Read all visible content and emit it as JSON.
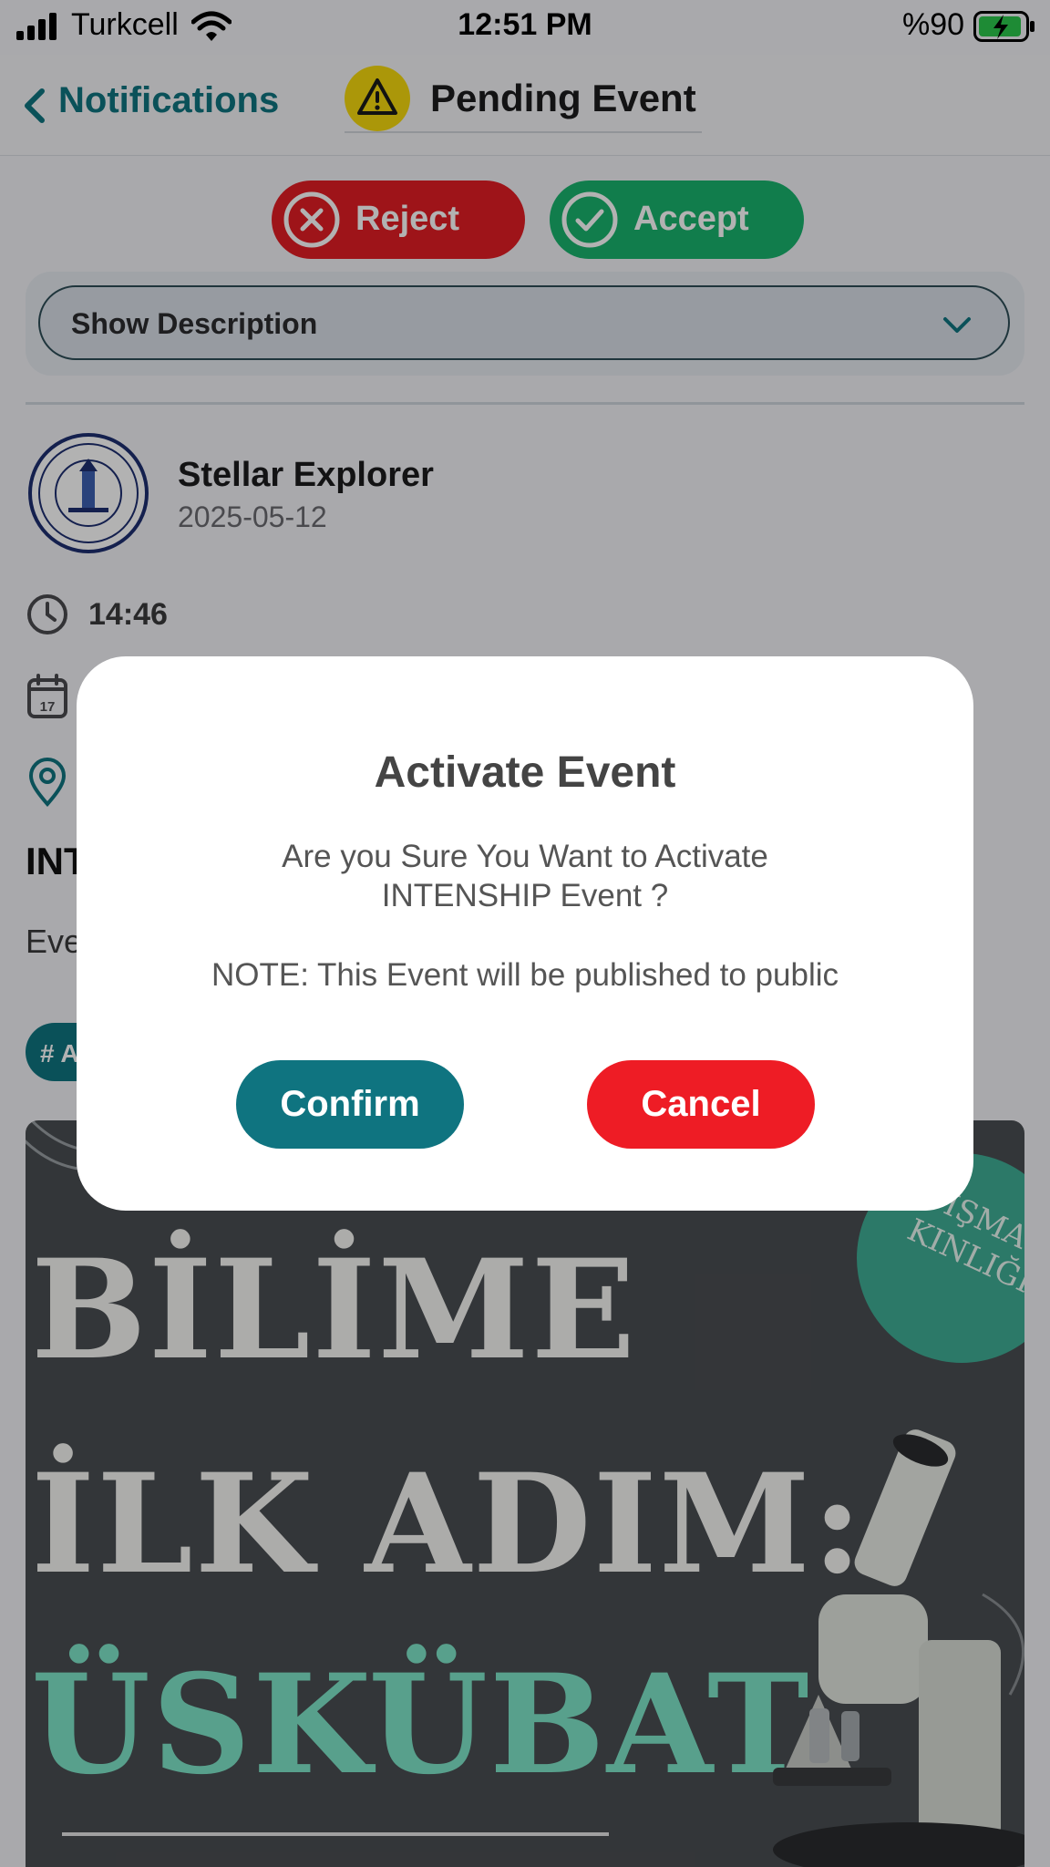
{
  "status_bar": {
    "carrier": "Turkcell",
    "time": "12:51 PM",
    "battery": "%90"
  },
  "nav": {
    "back_label": "Notifications",
    "title": "Pending Event"
  },
  "actions": {
    "reject_label": "Reject",
    "accept_label": "Accept"
  },
  "description": {
    "toggle_label": "Show Description"
  },
  "event": {
    "club_name": "Stellar Explorer",
    "date": "2025-05-12",
    "time": "14:46",
    "title": "INT",
    "description_preview": "Eve",
    "tag": "# A"
  },
  "poster": {
    "line1": "BİLİME",
    "line2": "İLK ADIM:",
    "line3": "ÜSKÜBAT",
    "badge": "IŞMA\nKINLIĞI"
  },
  "modal": {
    "title": "Activate Event",
    "message": "Are you Sure You Want to Activate INTENSHIP Event ?",
    "note": "NOTE: This Event will be published to public",
    "confirm_label": "Confirm",
    "cancel_label": "Cancel"
  },
  "colors": {
    "accent": "#0f7480",
    "reject": "#e31e24",
    "accept": "#19b36e",
    "cancel": "#ee1c25",
    "warning": "#f5d90e"
  }
}
